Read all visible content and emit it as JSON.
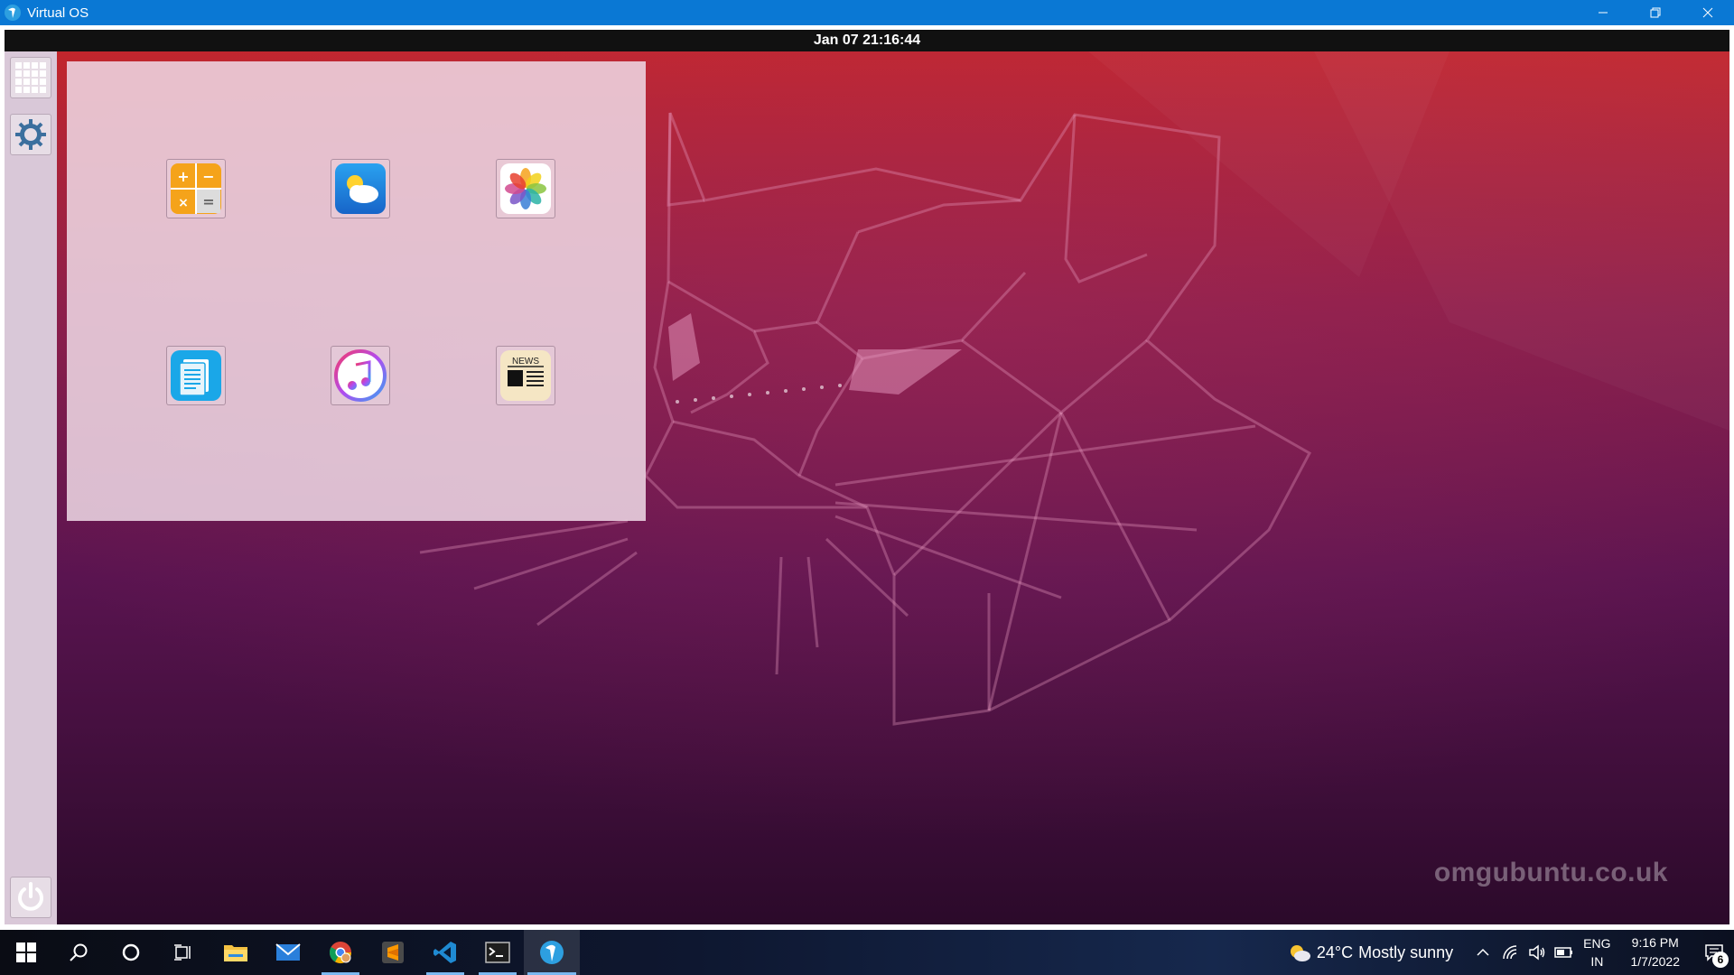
{
  "window": {
    "title": "Virtual OS",
    "controls": {
      "minimize": "–",
      "maximize": "❐",
      "close": "✕"
    }
  },
  "guest": {
    "clock": "Jan 07  21:16:44",
    "watermark": "omgubuntu.co.uk",
    "dock": [
      {
        "name": "app-grid-icon"
      },
      {
        "name": "settings-gear-icon"
      },
      {
        "name": "power-icon"
      }
    ],
    "launcher_apps": [
      {
        "name": "calculator",
        "icon": "calculator-icon"
      },
      {
        "name": "weather",
        "icon": "weather-cloud-icon"
      },
      {
        "name": "photos",
        "icon": "photos-flower-icon"
      },
      {
        "name": "text-editor",
        "icon": "document-icon"
      },
      {
        "name": "music",
        "icon": "music-note-icon"
      },
      {
        "name": "news",
        "icon": "news-icon",
        "label": "NEWS"
      }
    ]
  },
  "taskbar": {
    "pinned": [
      "start-icon",
      "search-icon",
      "cortana-icon",
      "task-view-icon",
      "file-explorer-icon",
      "mail-icon",
      "chrome-icon",
      "sublime-text-icon",
      "vscode-icon",
      "terminal-icon",
      "virtual-os-icon"
    ],
    "weather_temp": "24°C",
    "weather_text": "Mostly sunny",
    "lang_1": "ENG",
    "lang_2": "IN",
    "time": "9:16 PM",
    "date": "1/7/2022",
    "notification_count": "6"
  },
  "colors": {
    "titlebar": "#0a78d4",
    "wallpaper_top": "#c2262c",
    "wallpaper_bottom": "#2b0a2a",
    "dock": "#d9c8d8"
  }
}
